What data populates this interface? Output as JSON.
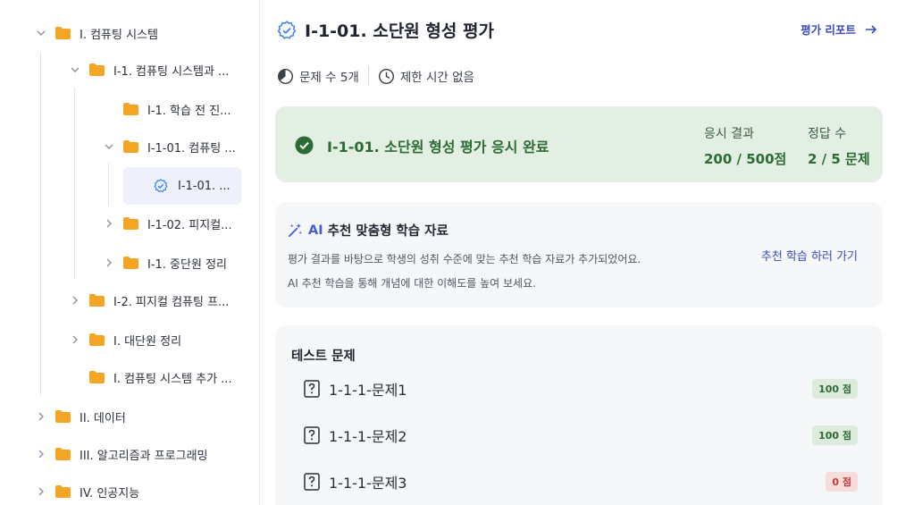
{
  "sidebar": {
    "items": [
      {
        "label": "I. 컴퓨팅 시스템",
        "expanded": true,
        "icon": "folder-icon"
      },
      {
        "label": "I-1. 컴퓨팅 시스템과 ...",
        "expanded": true,
        "icon": "folder-icon"
      },
      {
        "label": "I-1. 학습 전 진...",
        "icon": "folder-icon"
      },
      {
        "label": "I-1-01. 컴퓨팅 ...",
        "expanded": true,
        "icon": "folder-icon"
      },
      {
        "label": "I-1-01. ...",
        "selected": true,
        "icon": "check-circle-icon"
      },
      {
        "label": "I-1-02. 피지컬...",
        "expanded": false,
        "icon": "folder-icon"
      },
      {
        "label": "I-1. 중단원 정리",
        "expanded": false,
        "icon": "folder-icon"
      },
      {
        "label": "I-2. 피지컬 컴퓨팅 프...",
        "expanded": false,
        "icon": "folder-icon"
      },
      {
        "label": "I. 대단원 정리",
        "expanded": false,
        "icon": "folder-icon"
      },
      {
        "label": "I. 컴퓨팅 시스템 추가 ...",
        "icon": "folder-icon"
      },
      {
        "label": "II. 데이터",
        "expanded": false,
        "icon": "folder-icon"
      },
      {
        "label": "III. 알고리즘과 프로그래밍",
        "expanded": false,
        "icon": "folder-icon"
      },
      {
        "label": "IV. 인공지능",
        "expanded": false,
        "icon": "folder-icon"
      }
    ]
  },
  "header": {
    "title": "I-1-01. 소단원 형성 평가",
    "report_link": "평가 리포트"
  },
  "meta": {
    "question_count": "문제 수 5개",
    "time_limit": "제한 시간 없음"
  },
  "result": {
    "title": "I-1-01. 소단원 형성 평가 응시 완료",
    "score_label": "응시 결과",
    "score_value": "200 / 500점",
    "correct_label": "정답 수",
    "correct_value": "2 / 5 문제"
  },
  "ai": {
    "badge": "AI",
    "title": "추천 맞춤형 학습 자료",
    "desc1": "평가 결과를 바탕으로 학생의 성취 수준에 맞는 추천 학습 자료가 추가되었어요.",
    "desc2": "AI 추천 학습을 통해 개념에 대한 이해도를 높여 보세요.",
    "link": "추천 학습 하러 가기"
  },
  "tests": {
    "title": "테스트 문제",
    "items": [
      {
        "name": "1-1-1-문제1",
        "score": "100 점",
        "status": "pass"
      },
      {
        "name": "1-1-1-문제2",
        "score": "100 점",
        "status": "pass"
      },
      {
        "name": "1-1-1-문제3",
        "score": "0 점",
        "status": "fail"
      }
    ]
  },
  "colors": {
    "folder": "#f5a524",
    "accent": "#3d4bc4",
    "success": "#2c6b33",
    "success_bg": "#e3efe3",
    "fail": "#c33a3a"
  }
}
